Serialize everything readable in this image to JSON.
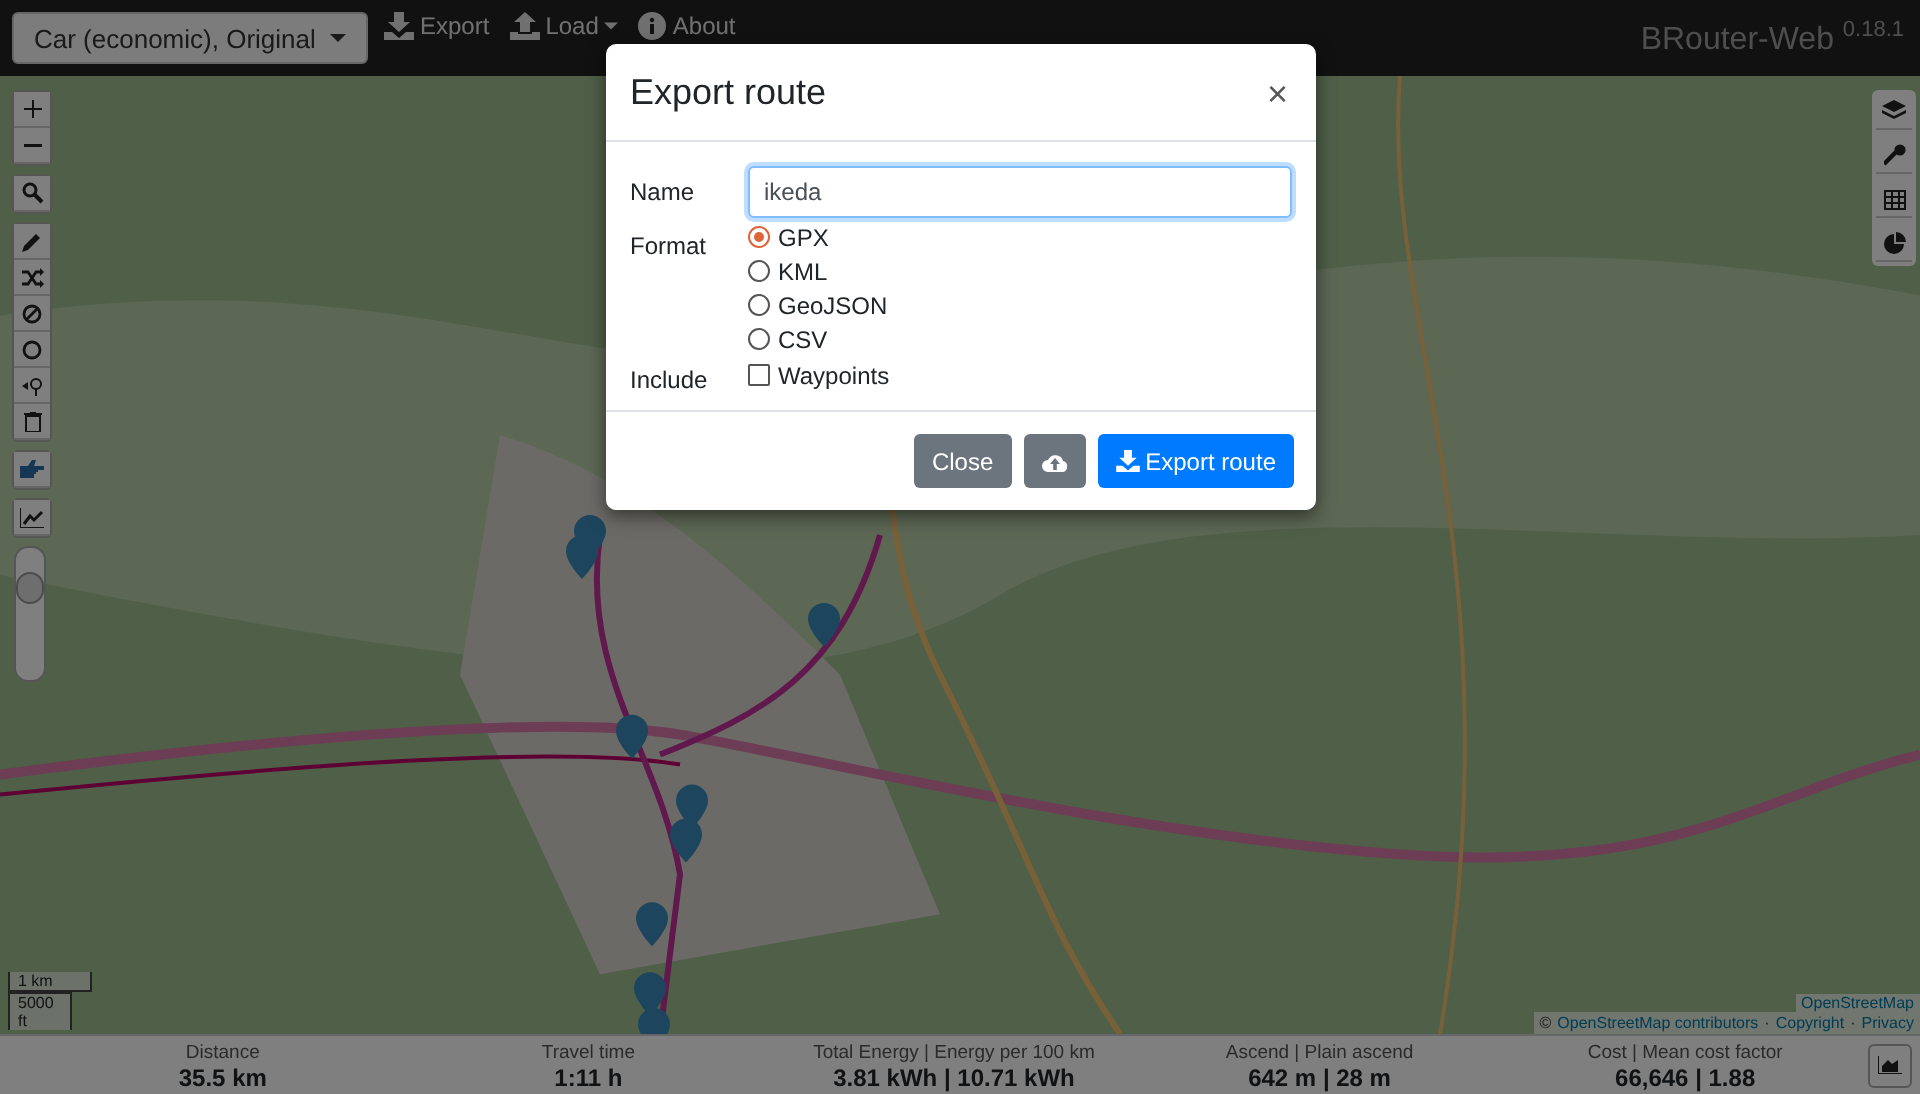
{
  "navbar": {
    "profile_select": "Car (economic), Original",
    "menu": [
      {
        "kind": "export",
        "label": "Export",
        "dropdown": false
      },
      {
        "kind": "load",
        "label": "Load",
        "dropdown": true
      },
      {
        "kind": "about",
        "label": "About",
        "dropdown": false
      }
    ],
    "brand": "BRouter-Web",
    "version": "0.18.1"
  },
  "map": {
    "opacity_slider": {
      "level": 0.75
    },
    "scale": [
      "1 km",
      "5000 ft"
    ],
    "layer_credit": "OpenStreetMap",
    "attribution": {
      "prefix": "©",
      "separator": "·",
      "links": [
        "OpenStreetMap contributors",
        "Copyright",
        "Privacy"
      ]
    }
  },
  "stats": [
    {
      "label": "Distance",
      "value": "35.5 km"
    },
    {
      "label": "Travel time",
      "value": "1:11 h"
    },
    {
      "label": "Total Energy | Energy per 100 km",
      "value": "3.81 kWh | 10.71 kWh"
    },
    {
      "label": "Ascend | Plain ascend",
      "value": "642 m | 28 m"
    },
    {
      "label": "Cost | Mean cost factor",
      "value": "66,646 | 1.88"
    }
  ],
  "dialog": {
    "title": "Export route",
    "close": "×",
    "name": {
      "label": "Name",
      "value": "ikeda"
    },
    "format": {
      "label": "Format",
      "options": [
        {
          "label": "GPX",
          "selected": true
        },
        {
          "label": "KML",
          "selected": false
        },
        {
          "label": "GeoJSON",
          "selected": false
        },
        {
          "label": "CSV",
          "selected": false
        }
      ]
    },
    "include": {
      "label": "Include",
      "options": [
        {
          "label": "Waypoints",
          "checked": false
        }
      ]
    },
    "buttons": [
      {
        "kind": "close",
        "label": "Close"
      },
      {
        "kind": "upload"
      },
      {
        "kind": "export",
        "label": "Export route"
      }
    ]
  }
}
